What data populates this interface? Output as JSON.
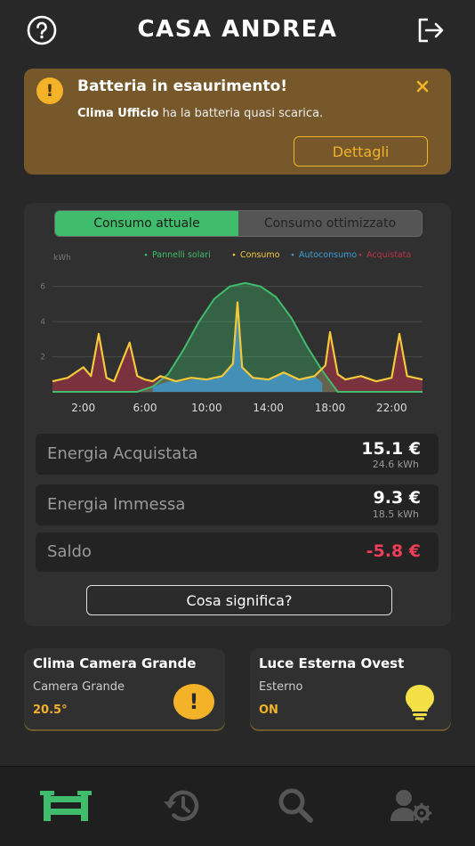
{
  "header": {
    "title": "CASA ANDREA",
    "help_icon": "help-circle-icon",
    "logout_icon": "logout-icon"
  },
  "alert": {
    "title": "Batteria in esaurimento!",
    "device": "Clima Ufficio",
    "message": " ha la batteria quasi scarica.",
    "button_label": "Dettagli",
    "icon": "exclamation-icon",
    "close_icon": "close-icon",
    "color": "#f3b227"
  },
  "energy": {
    "tabs": [
      {
        "label": "Consumo attuale",
        "active": true
      },
      {
        "label": "Consumo ottimizzato",
        "active": false
      }
    ],
    "stats": [
      {
        "label": "Energia Acquistata",
        "value": "15.1 €",
        "sub": "24.6  kWh"
      },
      {
        "label": "Energia Immessa",
        "value": "9.3 €",
        "sub": "18.5  kWh"
      },
      {
        "label": "Saldo",
        "value": "-5.8 €"
      }
    ],
    "info_button": "Cosa significa?"
  },
  "chart_data": {
    "type": "area",
    "ylabel": "kWh",
    "ylim": [
      0,
      7
    ],
    "yticks": [
      "2",
      "4",
      "6"
    ],
    "x_tick_labels": [
      "2:00",
      "6:00",
      "10:00",
      "14:00",
      "18:00",
      "22:00"
    ],
    "legend_position": "top-right",
    "series": [
      {
        "name": "Pannelli solari",
        "color": "#3fbd6c",
        "x": [
          0,
          5.5,
          6.5,
          7.5,
          8.5,
          9.5,
          10.5,
          11.5,
          12.5,
          13.5,
          14.5,
          15.5,
          16.5,
          17.5,
          18.5,
          24
        ],
        "values": [
          0,
          0,
          0.3,
          1.0,
          2.4,
          4.0,
          5.3,
          6.0,
          6.2,
          6.0,
          5.4,
          4.2,
          2.6,
          1.2,
          0,
          0
        ]
      },
      {
        "name": "Consumo",
        "color": "#f3c93a",
        "x": [
          0,
          1,
          2,
          2.5,
          3,
          3.5,
          4,
          5,
          5.5,
          6,
          6.5,
          7,
          8,
          9,
          10,
          11,
          11.7,
          12,
          12.3,
          13,
          14,
          15,
          16,
          17,
          17.7,
          18,
          18.5,
          19,
          20,
          21,
          22,
          22.5,
          23,
          24
        ],
        "values": [
          0.6,
          0.8,
          1.4,
          0.9,
          3.3,
          0.8,
          0.6,
          2.8,
          0.9,
          0.7,
          0.6,
          0.9,
          0.6,
          0.8,
          0.7,
          0.9,
          1.6,
          5.1,
          1.4,
          0.8,
          0.7,
          1.1,
          0.7,
          0.9,
          1.5,
          3.4,
          1.0,
          0.7,
          0.9,
          0.6,
          0.8,
          3.3,
          0.9,
          0.7
        ]
      },
      {
        "name": "Autoconsumo",
        "color": "#3a9fd8",
        "x": [
          6.5,
          7.5,
          8.5,
          9.5,
          10.5,
          11,
          11.7,
          12,
          12.3,
          13,
          14,
          15,
          16,
          17,
          17.5
        ],
        "values": [
          0.3,
          0.6,
          0.6,
          0.8,
          0.7,
          0.9,
          1.6,
          5.1,
          1.4,
          0.8,
          0.7,
          1.1,
          0.7,
          0.9,
          0.5
        ]
      },
      {
        "name": "Acquistata",
        "color": "#b8344c"
      }
    ]
  },
  "devices": [
    {
      "title": "Clima Camera Grande",
      "room": "Camera Grande",
      "value": "20.5°",
      "icon": "warning-icon"
    },
    {
      "title": "Luce Esterna Ovest",
      "room": "Esterno",
      "value": "ON",
      "icon": "lightbulb-icon"
    }
  ],
  "nav": [
    {
      "name": "home",
      "icon": "home-icon",
      "active": true
    },
    {
      "name": "history",
      "icon": "history-icon",
      "active": false
    },
    {
      "name": "search",
      "icon": "search-icon",
      "active": false
    },
    {
      "name": "user-settings",
      "icon": "user-settings-icon",
      "active": false
    }
  ]
}
